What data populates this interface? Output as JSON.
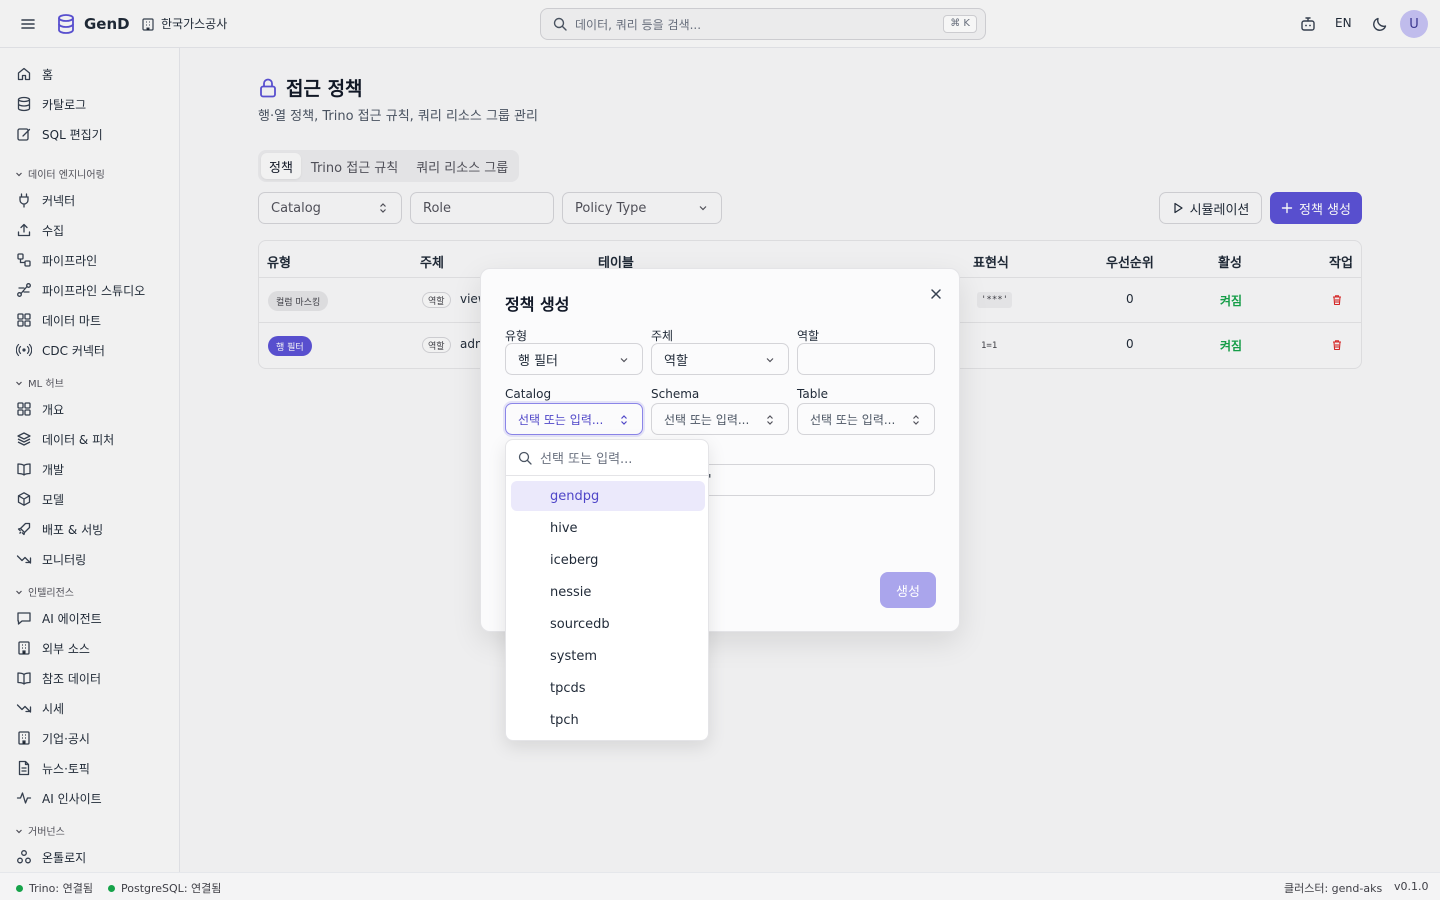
{
  "header": {
    "app_name": "GenD",
    "org_name": "한국가스공사",
    "search_placeholder": "데이터, 쿼리 등을 검색...",
    "search_shortcut": "⌘ K",
    "lang": "EN",
    "avatar_initial": "U"
  },
  "sidebar": {
    "top_items": [
      {
        "label": "홈",
        "icon": "home-icon"
      },
      {
        "label": "카탈로그",
        "icon": "database-icon"
      },
      {
        "label": "SQL 편집기",
        "icon": "edit-icon"
      }
    ],
    "sections": [
      {
        "title": "데이터 엔지니어링",
        "items": [
          "커넥터",
          "수집",
          "파이프라인",
          "파이프라인 스튜디오",
          "데이터 마트",
          "CDC 커넥터"
        ]
      },
      {
        "title": "ML 허브",
        "items": [
          "개요",
          "데이터 & 피처",
          "개발",
          "모델",
          "배포 & 서빙",
          "모니터링"
        ]
      },
      {
        "title": "인텔리전스",
        "items": [
          "AI 에이전트",
          "외부 소스",
          "참조 데이터",
          "시세",
          "기업·공시",
          "뉴스·토픽",
          "AI 인사이트"
        ]
      },
      {
        "title": "거버넌스",
        "items": [
          "온톨로지"
        ]
      }
    ]
  },
  "page": {
    "title": "접근 정책",
    "subtitle": "행·열 정책, Trino 접근 규칙, 쿼리 리소스 그룹 관리",
    "tabs": [
      "정책",
      "Trino 접근 규칙",
      "쿼리 리소스 그룹"
    ],
    "filters": {
      "catalog": "Catalog",
      "role": "Role",
      "policy_type": "Policy Type"
    },
    "simulate_label": "시뮬레이션",
    "create_label": "정책 생성"
  },
  "table": {
    "headers": [
      "유형",
      "주체",
      "테이블",
      "표현식",
      "우선순위",
      "활성",
      "작업"
    ],
    "rows": [
      {
        "type": "컬럼 마스킹",
        "subject_badge": "역할",
        "subject": "view",
        "expression": "'***'",
        "priority": "0",
        "active": "켜짐"
      },
      {
        "type": "행 필터",
        "subject_badge": "역할",
        "subject": "adm",
        "expression": "1=1",
        "priority": "0",
        "active": "켜짐"
      }
    ]
  },
  "dialog": {
    "title": "정책 생성",
    "labels": {
      "type": "유형",
      "subject": "주체",
      "role": "역할",
      "catalog": "Catalog",
      "schema": "Schema",
      "table": "Table"
    },
    "values": {
      "type": "행 필터",
      "subject": "역할",
      "role": ""
    },
    "placeholder": "선택 또는 입력...",
    "hidden_field_tail": "'",
    "submit_label": "생성"
  },
  "dropdown": {
    "search_placeholder": "선택 또는 입력...",
    "options": [
      "gendpg",
      "hive",
      "iceberg",
      "nessie",
      "sourcedb",
      "system",
      "tpcds",
      "tpch"
    ],
    "highlighted": "gendpg"
  },
  "footer": {
    "trino_status": "Trino: 연결됨",
    "postgres_status": "PostgreSQL: 연결됨",
    "cluster": "클러스터: gend-aks",
    "version": "v0.1.0"
  },
  "colors": {
    "accent": "#5b52d6",
    "success": "#16a34a",
    "danger": "#dc2626"
  }
}
